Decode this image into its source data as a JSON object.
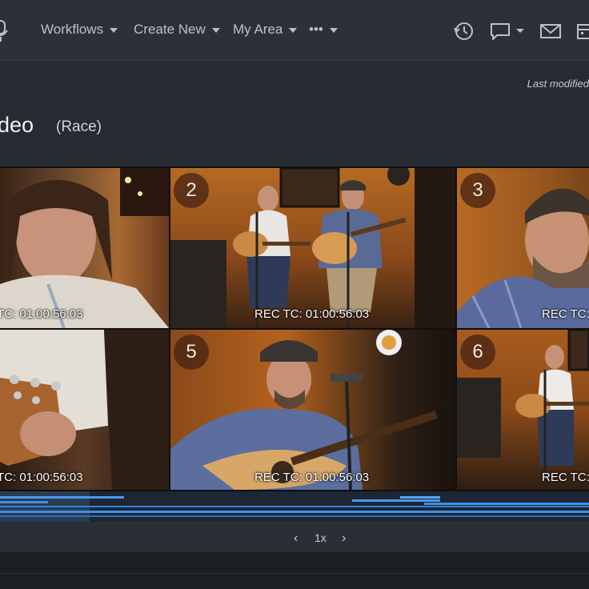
{
  "nav": {
    "workflows": "Workflows",
    "create_new": "Create New",
    "my_area": "My Area",
    "more": "•••"
  },
  "header": {
    "last_modified": "Last modified",
    "title": "deo",
    "subtitle": "(Race)"
  },
  "video_grid": {
    "cells": [
      {
        "number": "",
        "timecode": "TC: 01:00:56:03"
      },
      {
        "number": "2",
        "timecode": "REC TC: 01:00:56:03"
      },
      {
        "number": "3",
        "timecode": "REC TC:"
      },
      {
        "number": "",
        "timecode": "TC: 01:00:56:03"
      },
      {
        "number": "5",
        "timecode": "REC TC: 01:00:56:03"
      },
      {
        "number": "6",
        "timecode": "REC TC:"
      }
    ]
  },
  "playback": {
    "prev": "‹",
    "speed": "1x",
    "next": "›"
  },
  "colors": {
    "accent_blue": "#3f8fe6",
    "topbar": "#2c3138",
    "background": "#1d2127"
  }
}
